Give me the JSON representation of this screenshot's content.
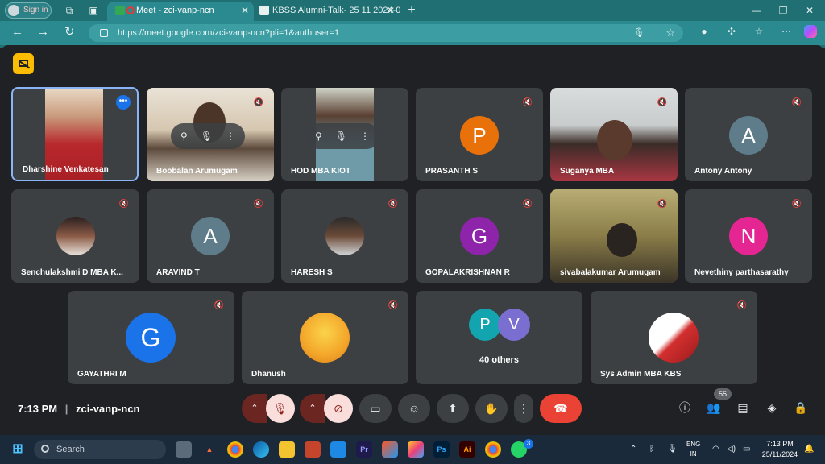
{
  "browser": {
    "sign_in": "Sign in",
    "tabs": [
      {
        "title": "Meet - zci-vanp-ncn",
        "active": true
      },
      {
        "title": "KBSS Alumni-Talk- 25 11 2024-0",
        "active": false
      }
    ],
    "new_tab": "+",
    "url": "https://meet.google.com/zci-vanp-ncn?pli=1&authuser=1",
    "window_controls": [
      "—",
      "❐",
      "✕"
    ]
  },
  "meet": {
    "meeting_time": "7:13 PM",
    "meeting_code": "zci-vanp-ncn",
    "participant_count": "55",
    "accent": "#1a73e8",
    "end_call_color": "#ea4335",
    "participants": [
      {
        "name": "Dharshine Venkatesan",
        "type": "video"
      },
      {
        "name": "Boobalan Arumugam",
        "type": "video"
      },
      {
        "name": "HOD MBA KIOT",
        "type": "video"
      },
      {
        "name": "PRASANTH S",
        "type": "avatar",
        "initial": "P",
        "color": "#e8710a"
      },
      {
        "name": "Suganya MBA",
        "type": "video"
      },
      {
        "name": "Antony Antony",
        "type": "avatar",
        "initial": "A",
        "color": "#5f7c8a"
      },
      {
        "name": "Senchulakshmi D MBA K...",
        "type": "photo"
      },
      {
        "name": "ARAVIND T",
        "type": "avatar",
        "initial": "A",
        "color": "#5f7c8a"
      },
      {
        "name": "HARESH S",
        "type": "photo"
      },
      {
        "name": "GOPALAKRISHNAN R",
        "type": "avatar",
        "initial": "G",
        "color": "#8e24aa"
      },
      {
        "name": "sivabalakumar Arumugam",
        "type": "video"
      },
      {
        "name": "Nevethiny parthasarathy",
        "type": "avatar",
        "initial": "N",
        "color": "#e52592"
      },
      {
        "name": "GAYATHRI M",
        "type": "avatar",
        "initial": "G",
        "color": "#1a73e8"
      },
      {
        "name": "Dhanush",
        "type": "photo"
      },
      {
        "name": "40 others",
        "type": "others",
        "initials": [
          "P",
          "V"
        ]
      },
      {
        "name": "Sys Admin MBA KBS",
        "type": "photo"
      }
    ]
  },
  "taskbar": {
    "search_placeholder": "Search",
    "lang_top": "ENG",
    "lang_bottom": "IN",
    "time": "7:13 PM",
    "date": "25/11/2024",
    "whatsapp_badge": "3"
  }
}
